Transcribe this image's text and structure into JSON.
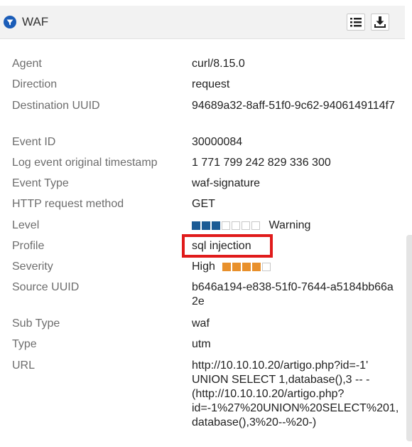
{
  "header": {
    "title": "WAF",
    "icon": "filter-icon",
    "accent_color": "#1b5db8",
    "buttons": [
      {
        "name": "list-view",
        "icon": "list-icon"
      },
      {
        "name": "download",
        "icon": "download-icon"
      }
    ]
  },
  "fields": {
    "agent": {
      "label": "Agent",
      "value": "curl/8.15.0"
    },
    "direction": {
      "label": "Direction",
      "value": "request"
    },
    "destination_uuid": {
      "label": "Destination UUID",
      "value": "94689a32-8aff-51f0-9c62-9406149114f7"
    },
    "event_id": {
      "label": "Event ID",
      "value": "30000084"
    },
    "log_timestamp": {
      "label": "Log event original timestamp",
      "value": "1 771 799 242 829 336 300"
    },
    "event_type": {
      "label": "Event Type",
      "value": "waf-signature"
    },
    "http_method": {
      "label": "HTTP request method",
      "value": "GET"
    },
    "level": {
      "label": "Level",
      "value": "Warning",
      "filled": 3,
      "total": 7,
      "color": "#1b5b95"
    },
    "profile": {
      "label": "Profile",
      "value": "sql injection"
    },
    "severity": {
      "label": "Severity",
      "value": "High",
      "filled": 4,
      "total": 5,
      "color": "#e8902c"
    },
    "source_uuid": {
      "label": "Source UUID",
      "value": "b646a194-e838-51f0-7644-a5184bb66a2e"
    },
    "sub_type": {
      "label": "Sub Type",
      "value": "waf"
    },
    "type": {
      "label": "Type",
      "value": "utm"
    },
    "url": {
      "label": "URL",
      "value": "http://10.10.10.20/artigo.php?id=-1' UNION SELECT 1,database(),3 -- -(http://10.10.10.20/artigo.php?id=-1%27%20UNION%20SELECT%201,database(),3%20--%20-)"
    }
  },
  "highlight_color": "#e01b1b"
}
